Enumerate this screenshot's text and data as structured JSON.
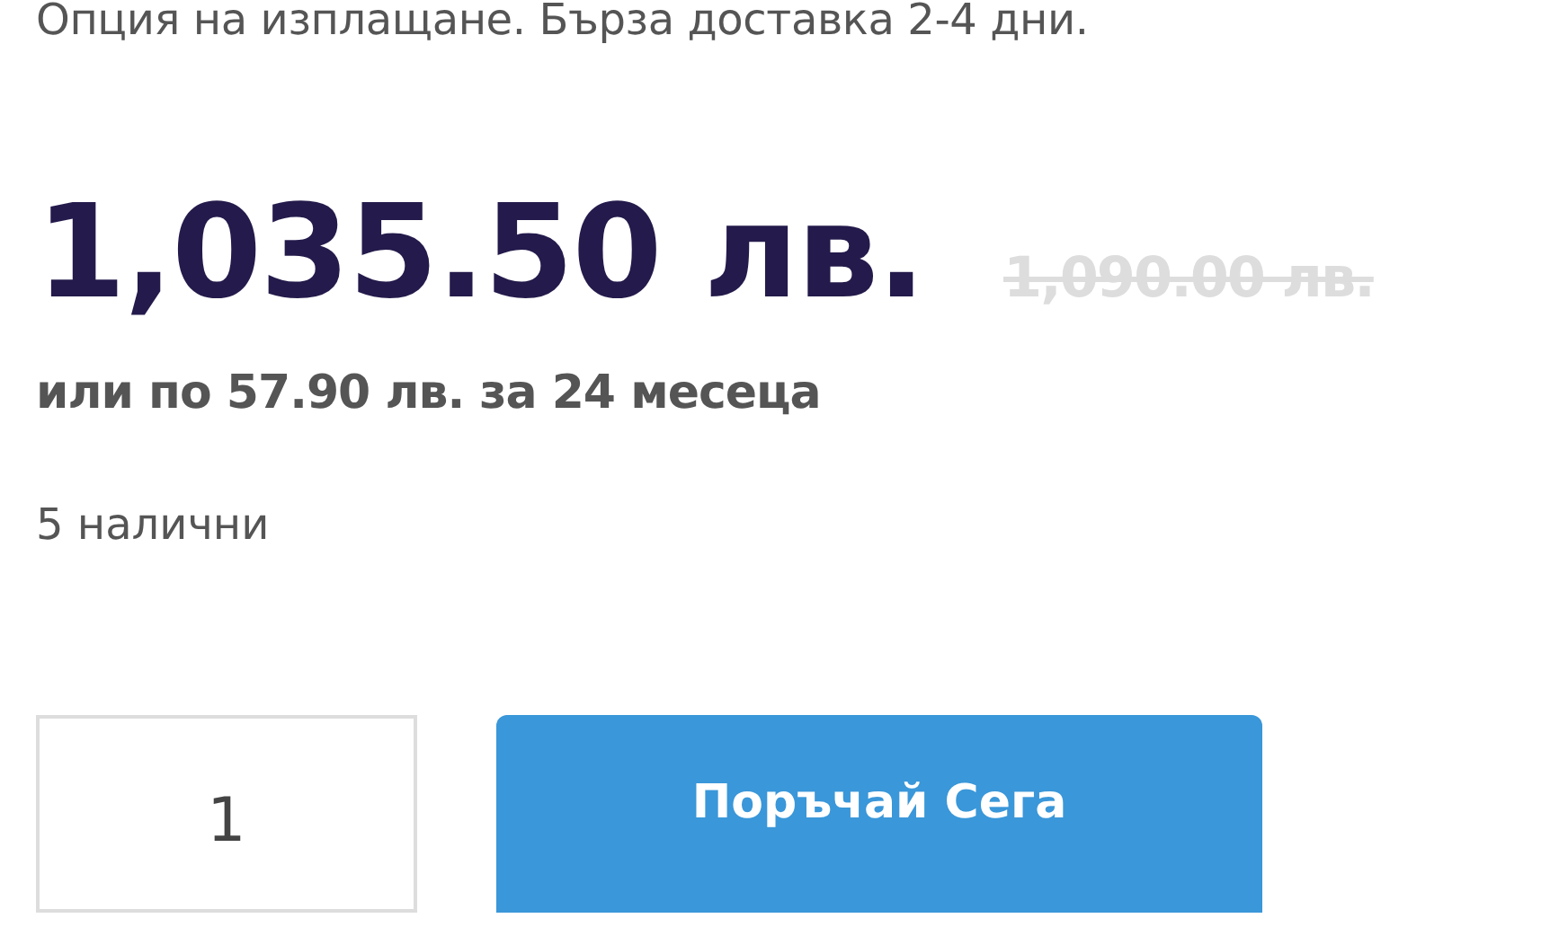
{
  "payment_note": "Опция на изплащане. Бърза доставка 2-4 дни.",
  "price": "1,035.50 лв.",
  "old_price": "1,090.00 лв.",
  "installment": "или по 57.90 лв. за 24 месеца",
  "stock": "5 налични",
  "quantity": {
    "value": "1"
  },
  "order_button": "Поръчай Сега"
}
